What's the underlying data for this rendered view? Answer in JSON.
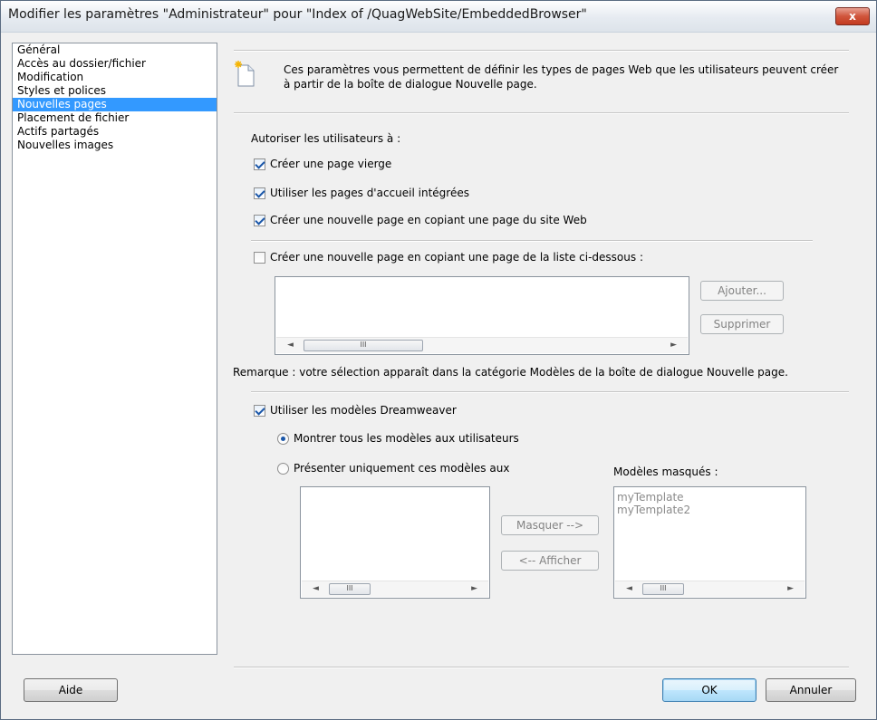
{
  "window": {
    "title": "Modifier les paramètres \"Administrateur\" pour \"Index of /QuagWebSite/EmbeddedBrowser\"",
    "close_label": "x"
  },
  "sidebar": {
    "items": [
      {
        "label": "Général",
        "selected": false
      },
      {
        "label": "Accès au dossier/fichier",
        "selected": false
      },
      {
        "label": "Modification",
        "selected": false
      },
      {
        "label": "Styles et polices",
        "selected": false
      },
      {
        "label": "Nouvelles pages",
        "selected": true
      },
      {
        "label": "Placement de fichier",
        "selected": false
      },
      {
        "label": "Actifs partagés",
        "selected": false
      },
      {
        "label": "Nouvelles images",
        "selected": false
      }
    ]
  },
  "description": "Ces paramètres vous permettent de définir les types de pages Web que les utilisateurs peuvent créer à partir de la boîte de dialogue Nouvelle page.",
  "allow_label": "Autoriser les utilisateurs à :",
  "options": {
    "blank_page": {
      "label": "Créer une page vierge",
      "checked": true
    },
    "builtin_pages": {
      "label": "Utiliser les pages d'accueil intégrées",
      "checked": true
    },
    "copy_site_page": {
      "label": "Créer une nouvelle page en copiant une page du site Web",
      "checked": true
    },
    "copy_list_page": {
      "label": "Créer une nouvelle page en copiant une page de la liste ci-dessous :",
      "checked": false
    }
  },
  "list_buttons": {
    "add": "Ajouter...",
    "remove": "Supprimer"
  },
  "note": "Remarque : votre sélection apparaît dans la catégorie Modèles de la boîte de dialogue Nouvelle page.",
  "dreamweaver": {
    "label": "Utiliser les modèles Dreamweaver",
    "checked": true,
    "radio_all": {
      "label": "Montrer tous les modèles aux utilisateurs",
      "selected": true
    },
    "radio_some": {
      "label": "Présenter uniquement ces modèles aux",
      "selected": false
    }
  },
  "hidden_templates": {
    "label": "Modèles masqués :",
    "items": [
      "myTemplate",
      "myTemplate2"
    ]
  },
  "move_buttons": {
    "hide": "Masquer -->",
    "show": "<-- Afficher"
  },
  "scroll_glyphs": {
    "left": "◄",
    "right": "►",
    "thumb": "III"
  },
  "footer": {
    "help": "Aide",
    "ok": "OK",
    "cancel": "Annuler"
  }
}
